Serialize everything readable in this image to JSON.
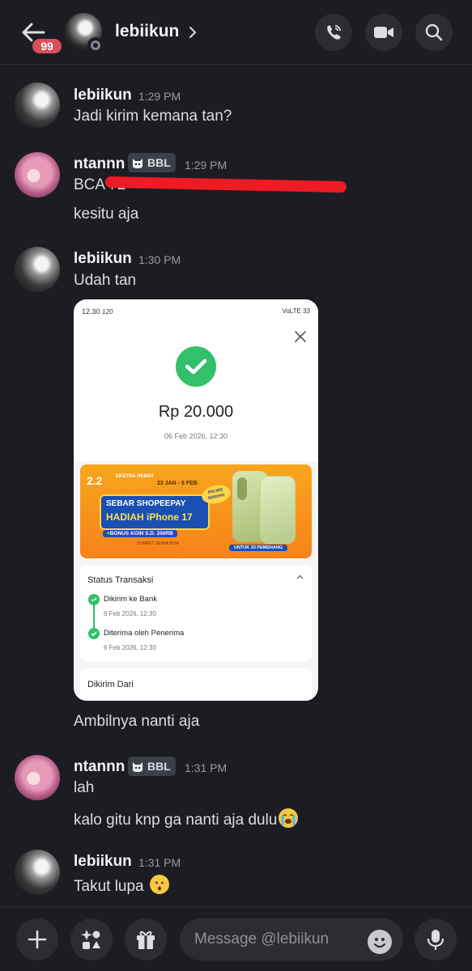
{
  "header": {
    "unread_count": "99",
    "channel_name": "lebiikun"
  },
  "messages": [
    {
      "author": "lebiikun",
      "time": "1:29 PM",
      "lines": [
        "Jadi kirim kemana tan?"
      ]
    },
    {
      "author": "ntannn",
      "role_tag": "BBL",
      "time": "1:29 PM",
      "lines": [
        "BCA 72",
        "kesitu aja"
      ]
    },
    {
      "author": "lebiikun",
      "time": "1:30 PM",
      "lines": [
        "Udah tan",
        "Ambilnya nanti aja"
      ]
    },
    {
      "author": "ntannn",
      "role_tag": "BBL",
      "time": "1:31 PM",
      "lines": [
        "lah",
        "kalo gitu knp ga nanti aja dulu"
      ]
    },
    {
      "author": "lebiikun",
      "time": "1:31 PM",
      "lines": [
        "Takut lupa"
      ]
    }
  ],
  "attachment": {
    "status_time": "12.30",
    "status_extra": "120",
    "status_right": "VoLTE 33",
    "amount": "Rp 20.000",
    "date": "06 Feb 2026, 12:30",
    "banner": {
      "promo_big": "2.2",
      "promo_small": "EKSTRA HEMAT",
      "dates": "23 JAN - 8 FEB",
      "line1": "SEBAR SHOPEEPAY",
      "line2": "HADIAH iPhone 17",
      "bonus": "+BONUS KOIN S.D. 200RB",
      "wallet": "DOMPET SERBA BISA",
      "sticker": "PALING BANYAK",
      "winners": "UNTUK 20 PEMENANG"
    },
    "status_title": "Status Transaksi",
    "steps": [
      {
        "label": "Dikirim ke Bank",
        "time": "6 Feb 2026, 12:30"
      },
      {
        "label": "Diterima oleh Penerima",
        "time": "6 Feb 2026, 12:30"
      }
    ],
    "sender_title": "Dikirim Dari"
  },
  "composer": {
    "placeholder": "Message @lebiikun"
  },
  "icons": {
    "back": "arrow-left-icon",
    "call": "phone-icon",
    "video": "video-camera-icon",
    "search": "search-icon",
    "add": "plus-icon",
    "apps": "apps-icon",
    "gift": "gift-icon",
    "emoji": "emoji-icon",
    "mic": "microphone-icon"
  },
  "colors": {
    "background": "#1c1d23",
    "badge": "#d8505a",
    "success": "#33c06a",
    "redaction": "#ee1b24"
  }
}
